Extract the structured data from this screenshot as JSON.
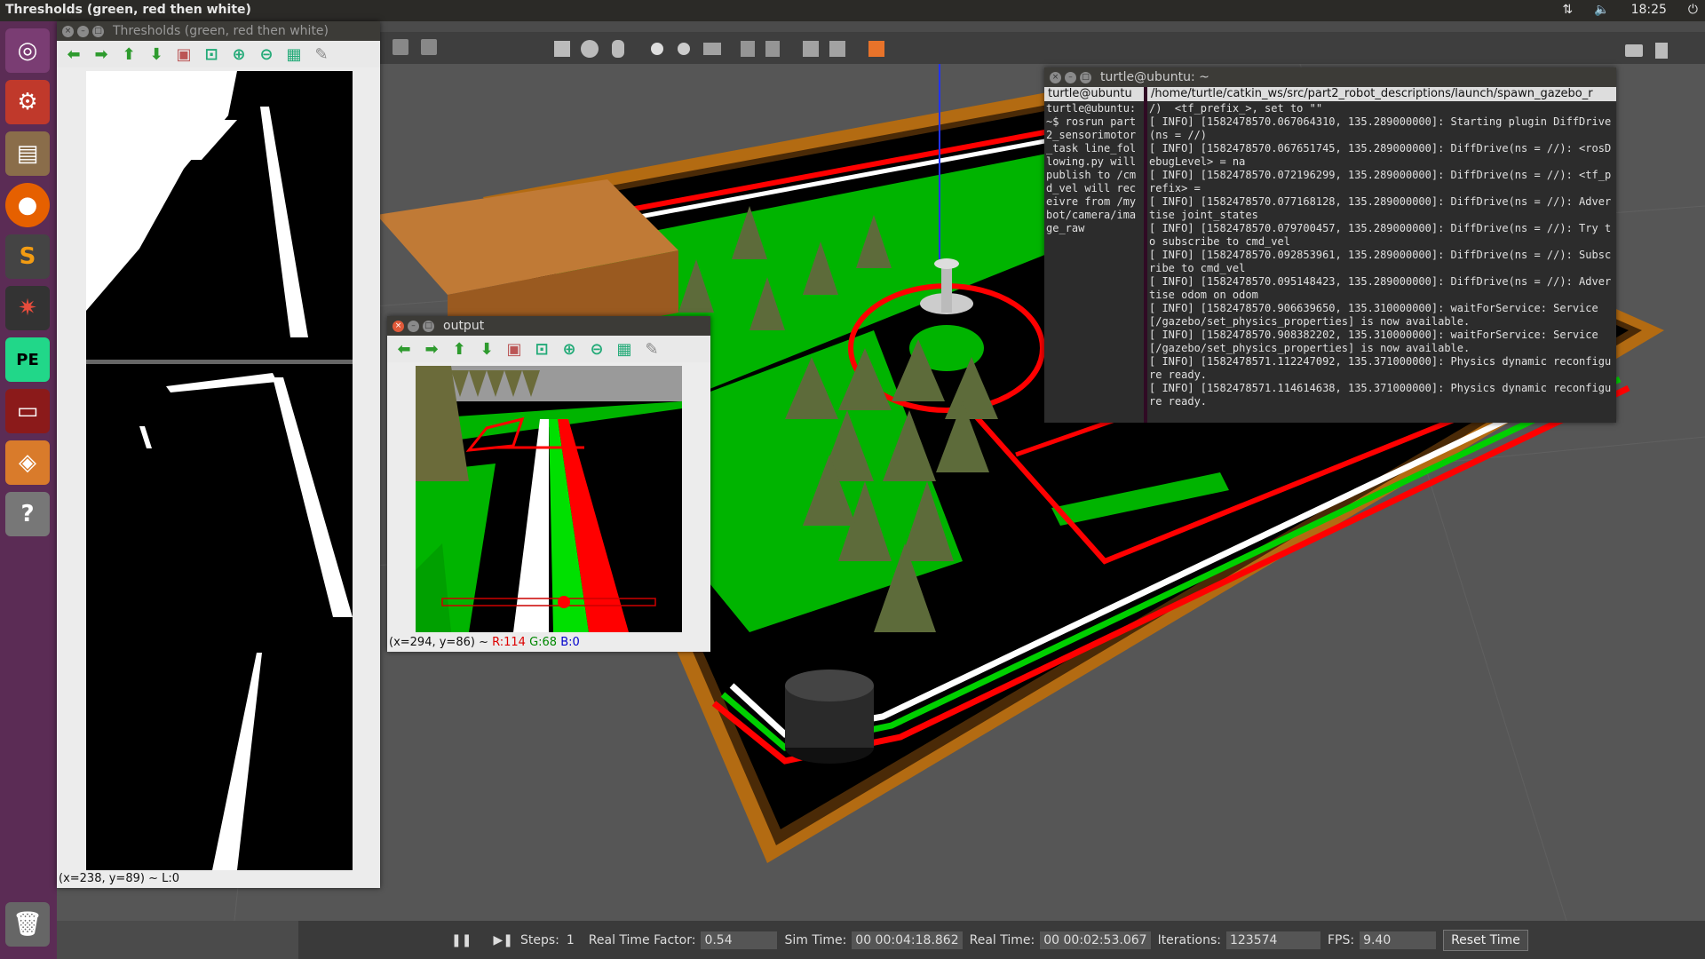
{
  "top_panel": {
    "title": "Thresholds (green, red then white)",
    "time": "18:25"
  },
  "launcher": {
    "items": [
      "ubuntu-icon",
      "settings-icon",
      "files-icon",
      "firefox-icon",
      "sublime-icon",
      "rviz-icon",
      "pycharm-icon",
      "terminal-icon",
      "gazebo-icon",
      "help-icon",
      "trash-icon"
    ]
  },
  "gazebo": {
    "bottom": {
      "steps_label": "Steps:",
      "steps_value": "1",
      "rtf_label": "Real Time Factor:",
      "rtf_value": "0.54",
      "sim_label": "Sim Time:",
      "sim_value": "00 00:04:18.862",
      "real_label": "Real Time:",
      "real_value": "00 00:02:53.067",
      "iter_label": "Iterations:",
      "iter_value": "123574",
      "fps_label": "FPS:",
      "fps_value": "9.40",
      "reset_label": "Reset Time"
    }
  },
  "thresholds_window": {
    "title": "Thresholds (green, red then white)",
    "status": "(x=238, y=89) ~ L:0"
  },
  "output_window": {
    "title": "output",
    "status_prefix": "(x=294, y=86) ~",
    "r": "R:114",
    "g": "G:68",
    "b": "B:0"
  },
  "terminal": {
    "title": "turtle@ubuntu: ~",
    "left_tab": "turtle@ubuntu",
    "left_text": "turtle@ubuntu:~$ rosrun part2_sensorimotor_task line_following.py will publish to /cmd_vel will receivre from /mybot/camera/image_raw",
    "right_tab": "/home/turtle/catkin_ws/src/part2_robot_descriptions/launch/spawn_gazebo_r",
    "right_lines": [
      "/)  <tf_prefix_>, set to \"\"",
      "[ INFO] [1582478570.067064310, 135.289000000]: Starting plugin DiffDrive(ns = //)",
      "[ INFO] [1582478570.067651745, 135.289000000]: DiffDrive(ns = //): <rosDebugLevel> = na",
      "[ INFO] [1582478570.072196299, 135.289000000]: DiffDrive(ns = //): <tf_prefix> =",
      "[ INFO] [1582478570.077168128, 135.289000000]: DiffDrive(ns = //): Advertise joint_states",
      "[ INFO] [1582478570.079700457, 135.289000000]: DiffDrive(ns = //): Try to subscribe to cmd_vel",
      "[ INFO] [1582478570.092853961, 135.289000000]: DiffDrive(ns = //): Subscribe to cmd_vel",
      "[ INFO] [1582478570.095148423, 135.289000000]: DiffDrive(ns = //): Advertise odom on odom",
      "[ INFO] [1582478570.906639650, 135.310000000]: waitForService: Service [/gazebo/set_physics_properties] is now available.",
      "[ INFO] [1582478570.908382202, 135.310000000]: waitForService: Service [/gazebo/set_physics_properties] is now available.",
      "[ INFO] [1582478571.112247092, 135.371000000]: Physics dynamic reconfigure ready.",
      "[ INFO] [1582478571.114614638, 135.371000000]: Physics dynamic reconfigure ready."
    ]
  }
}
